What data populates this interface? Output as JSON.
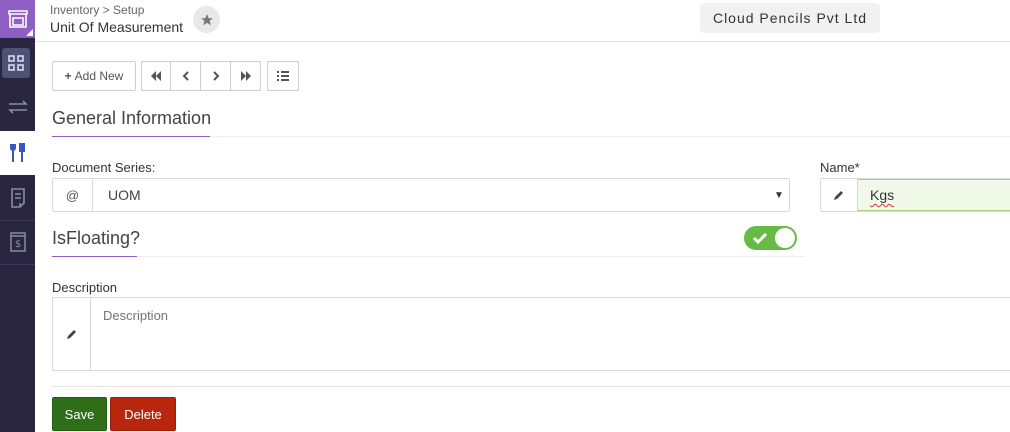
{
  "sidebar": {
    "items": [
      {
        "icon": "store-icon"
      },
      {
        "icon": "dashboard-grid-icon"
      },
      {
        "icon": "transfer-arrows-icon"
      },
      {
        "icon": "tools-icon"
      },
      {
        "icon": "document-icon"
      },
      {
        "icon": "invoice-dollar-icon"
      }
    ],
    "colors": {
      "background": "#2b2640",
      "logo": "#8e5ec4",
      "active": "#4d5276"
    }
  },
  "header": {
    "breadcrumb": "Inventory > Setup",
    "title": "Unit Of Measurement",
    "company": "Cloud Pencils Pvt Ltd"
  },
  "toolbar": {
    "add_new_label": "Add New"
  },
  "section": {
    "title": "General Information"
  },
  "form": {
    "document_series_label": "Document Series:",
    "document_series_prefix": "@",
    "document_series_value": "UOM",
    "name_label": "Name*",
    "name_value": "Kgs",
    "is_floating_label": "IsFloating?",
    "is_floating_on": true,
    "description_label": "Description",
    "description_placeholder": "Description"
  },
  "actions": {
    "save_label": "Save",
    "delete_label": "Delete",
    "save_color": "#2e6e18",
    "delete_color": "#b8260e"
  }
}
